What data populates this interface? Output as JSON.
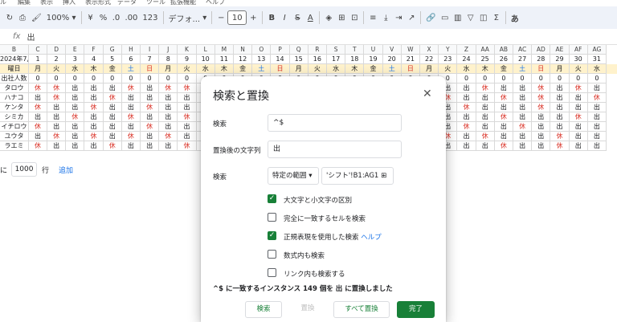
{
  "menubar": [
    "ル",
    "編集",
    "表示",
    "挿入",
    "表示形式",
    "データ",
    "ツール",
    "拡張機能",
    "ヘルプ"
  ],
  "toolbar": {
    "zoom": "100%",
    "currency": "¥",
    "percent": "%",
    "decimal1": ".0",
    "decimal2": ".00",
    "number_format": "123",
    "font": "デフォ...",
    "font_size": "10",
    "bold": "B",
    "italic": "I",
    "strike": "S",
    "text_color": "A",
    "text_color_bar": "#000000",
    "dropdown": "▾",
    "plus": "+",
    "minus": "−",
    "sum": "Σ",
    "input_tools": "あ"
  },
  "formula": {
    "name_box": "",
    "fx": "fx",
    "content": "出"
  },
  "grid": {
    "columns": [
      "B",
      "C",
      "D",
      "E",
      "F",
      "G",
      "H",
      "I",
      "J",
      "K",
      "L",
      "M",
      "N",
      "O",
      "P",
      "Q",
      "R",
      "S",
      "T",
      "U",
      "V",
      "W",
      "X",
      "Y",
      "Z",
      "AA",
      "AB",
      "AC",
      "AD",
      "AE",
      "AF",
      "AG"
    ],
    "header_label": "2024年7月",
    "days": [
      "1",
      "2",
      "3",
      "4",
      "5",
      "6",
      "7",
      "8",
      "9",
      "10",
      "11",
      "12",
      "13",
      "14",
      "15",
      "16",
      "17",
      "18",
      "19",
      "20",
      "21",
      "22",
      "23",
      "24",
      "25",
      "26",
      "27",
      "28",
      "29",
      "30",
      "31"
    ],
    "weekday_label": "曜日",
    "weekdays": [
      "月",
      "火",
      "水",
      "木",
      "金",
      "土",
      "日",
      "月",
      "火",
      "水",
      "木",
      "金",
      "土",
      "日",
      "月",
      "火",
      "水",
      "木",
      "金",
      "土",
      "日",
      "月",
      "火",
      "水",
      "木",
      "金",
      "土",
      "日",
      "月",
      "火",
      "水"
    ],
    "count_label": "出社人数",
    "counts": [
      "0",
      "0",
      "0",
      "0",
      "0",
      "0",
      "0",
      "0",
      "0",
      "0",
      "0",
      "0",
      "0",
      "0",
      "0",
      "0",
      "0",
      "0",
      "0",
      "0",
      "0",
      "0",
      "0",
      "0",
      "0",
      "0",
      "0",
      "0",
      "0",
      "0",
      "0"
    ],
    "staff": [
      {
        "name": "タロウ",
        "days": [
          "休",
          "休",
          "出",
          "出",
          "出",
          "休",
          "出",
          "休",
          "休",
          "出"
        ],
        "tail": [
          "出",
          "出",
          "休",
          "出",
          "出",
          "休",
          "出",
          "休",
          "出"
        ]
      },
      {
        "name": "ハナコ",
        "days": [
          "出",
          "休",
          "出",
          "出",
          "休",
          "出",
          "出",
          "出",
          "出",
          "出"
        ],
        "tail": [
          "休",
          "出",
          "出",
          "休",
          "出",
          "休",
          "出",
          "出",
          "休"
        ]
      },
      {
        "name": "ケンタ",
        "days": [
          "休",
          "出",
          "出",
          "休",
          "出",
          "出",
          "休",
          "出",
          "出",
          "出"
        ],
        "tail": [
          "出",
          "休",
          "出",
          "出",
          "出",
          "休",
          "出",
          "出",
          "出"
        ]
      },
      {
        "name": "シミカ",
        "days": [
          "出",
          "出",
          "休",
          "出",
          "出",
          "休",
          "出",
          "出",
          "休",
          "出"
        ],
        "tail": [
          "出",
          "出",
          "出",
          "休",
          "出",
          "出",
          "出",
          "休",
          "出"
        ]
      },
      {
        "name": "イチロウ",
        "days": [
          "休",
          "出",
          "出",
          "出",
          "出",
          "出",
          "休",
          "出",
          "出",
          "休"
        ],
        "tail": [
          "出",
          "休",
          "出",
          "出",
          "休",
          "出",
          "出",
          "出",
          "出"
        ]
      },
      {
        "name": "ユウタ",
        "days": [
          "出",
          "休",
          "出",
          "休",
          "出",
          "休",
          "出",
          "休",
          "出",
          "出"
        ],
        "tail": [
          "休",
          "出",
          "休",
          "出",
          "出",
          "出",
          "休",
          "出",
          "出"
        ]
      },
      {
        "name": "ラエミ",
        "days": [
          "休",
          "出",
          "出",
          "出",
          "休",
          "出",
          "出",
          "出",
          "休",
          "出"
        ],
        "tail": [
          "出",
          "出",
          "出",
          "休",
          "出",
          "出",
          "休",
          "出",
          "出"
        ]
      }
    ]
  },
  "addrows": {
    "prefix": "に",
    "value": "1000",
    "suffix": "行",
    "button": "追加"
  },
  "dialog": {
    "title": "検索と置換",
    "find_label": "検索",
    "find_value": "^$",
    "replace_label": "置換後の文字列",
    "replace_value": "出",
    "scope_label": "検索",
    "scope_value": "特定の範囲",
    "range_value": "'シフト'!B1:AG1",
    "options": [
      {
        "label": "大文字と小文字の区別",
        "checked": true
      },
      {
        "label": "完全に一致するセルを検索",
        "checked": false
      },
      {
        "label": "正規表現を使用した検索",
        "checked": true,
        "help": "ヘルプ"
      },
      {
        "label": "数式内も検索",
        "checked": false
      },
      {
        "label": "リンク内も検索する",
        "checked": false
      }
    ],
    "status": "^$ に一致するインスタンス 149 個を 出 に置換しました",
    "buttons": {
      "find": "検索",
      "replace": "置換",
      "replace_all": "すべて置換",
      "done": "完了"
    }
  }
}
